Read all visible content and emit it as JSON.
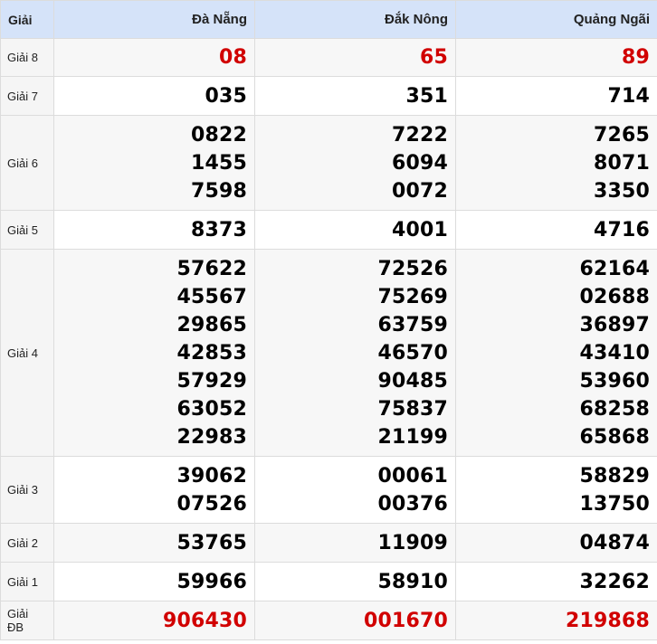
{
  "header": {
    "label": "Giải",
    "provinces": [
      "Đà Nẵng",
      "Đắk Nông",
      "Quảng Ngãi"
    ]
  },
  "colors": {
    "highlight": "#d10000",
    "header_bg": "#d5e3f9",
    "label_bg": "#f5f5f5"
  },
  "rows": [
    {
      "label": "Giải 8",
      "highlight": true,
      "values": [
        [
          "08"
        ],
        [
          "65"
        ],
        [
          "89"
        ]
      ]
    },
    {
      "label": "Giải 7",
      "highlight": false,
      "values": [
        [
          "035"
        ],
        [
          "351"
        ],
        [
          "714"
        ]
      ]
    },
    {
      "label": "Giải 6",
      "highlight": false,
      "values": [
        [
          "0822",
          "1455",
          "7598"
        ],
        [
          "7222",
          "6094",
          "0072"
        ],
        [
          "7265",
          "8071",
          "3350"
        ]
      ]
    },
    {
      "label": "Giải 5",
      "highlight": false,
      "values": [
        [
          "8373"
        ],
        [
          "4001"
        ],
        [
          "4716"
        ]
      ]
    },
    {
      "label": "Giải 4",
      "highlight": false,
      "values": [
        [
          "57622",
          "45567",
          "29865",
          "42853",
          "57929",
          "63052",
          "22983"
        ],
        [
          "72526",
          "75269",
          "63759",
          "46570",
          "90485",
          "75837",
          "21199"
        ],
        [
          "62164",
          "02688",
          "36897",
          "43410",
          "53960",
          "68258",
          "65868"
        ]
      ]
    },
    {
      "label": "Giải 3",
      "highlight": false,
      "values": [
        [
          "39062",
          "07526"
        ],
        [
          "00061",
          "00376"
        ],
        [
          "58829",
          "13750"
        ]
      ]
    },
    {
      "label": "Giải 2",
      "highlight": false,
      "values": [
        [
          "53765"
        ],
        [
          "11909"
        ],
        [
          "04874"
        ]
      ]
    },
    {
      "label": "Giải 1",
      "highlight": false,
      "values": [
        [
          "59966"
        ],
        [
          "58910"
        ],
        [
          "32262"
        ]
      ]
    },
    {
      "label": "Giải ĐB",
      "highlight": true,
      "values": [
        [
          "906430"
        ],
        [
          "001670"
        ],
        [
          "219868"
        ]
      ]
    }
  ]
}
